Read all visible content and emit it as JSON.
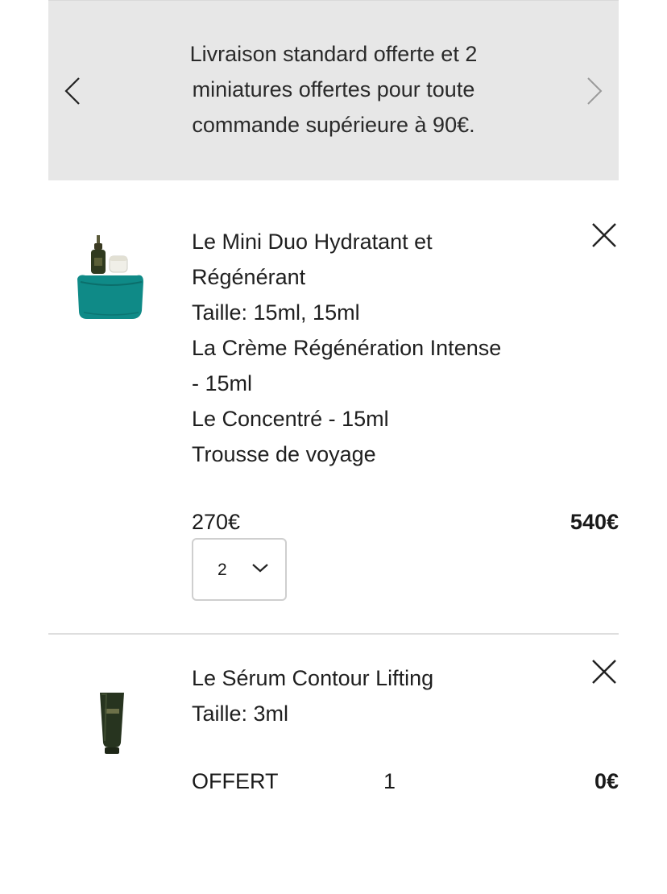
{
  "banner": {
    "lines": [
      "Livraison standard offerte et 2",
      "miniatures offertes pour toute",
      "commande supérieure à 90€."
    ],
    "prev_icon": "chevron-left-icon",
    "next_icon": "chevron-right-icon"
  },
  "cart": {
    "items": [
      {
        "name_line1": "Le Mini Duo Hydratant et",
        "name_line2": "Régénérant",
        "size": "Taille: 15ml, 15ml",
        "content_line1": "La Crème Régénération Intense",
        "content_line2": "- 15ml",
        "content_line3": "Le Concentré - 15ml",
        "content_line4": "Trousse de voyage",
        "unit_price": "270€",
        "total_price": "540€",
        "quantity": "2",
        "image_icon": "skincare-duo-kit-image"
      },
      {
        "name_line1": "Le Sérum Contour Lifting",
        "size": "Taille: 3ml",
        "free_label": "OFFERT",
        "quantity": "1",
        "total_price": "0€",
        "image_icon": "serum-tube-image"
      }
    ]
  },
  "colors": {
    "banner_bg": "#e7e7e7",
    "text": "#1f1f1f",
    "divider": "#dedede",
    "pouch_teal": "#0f8a87",
    "bottle_green": "#27341f"
  }
}
